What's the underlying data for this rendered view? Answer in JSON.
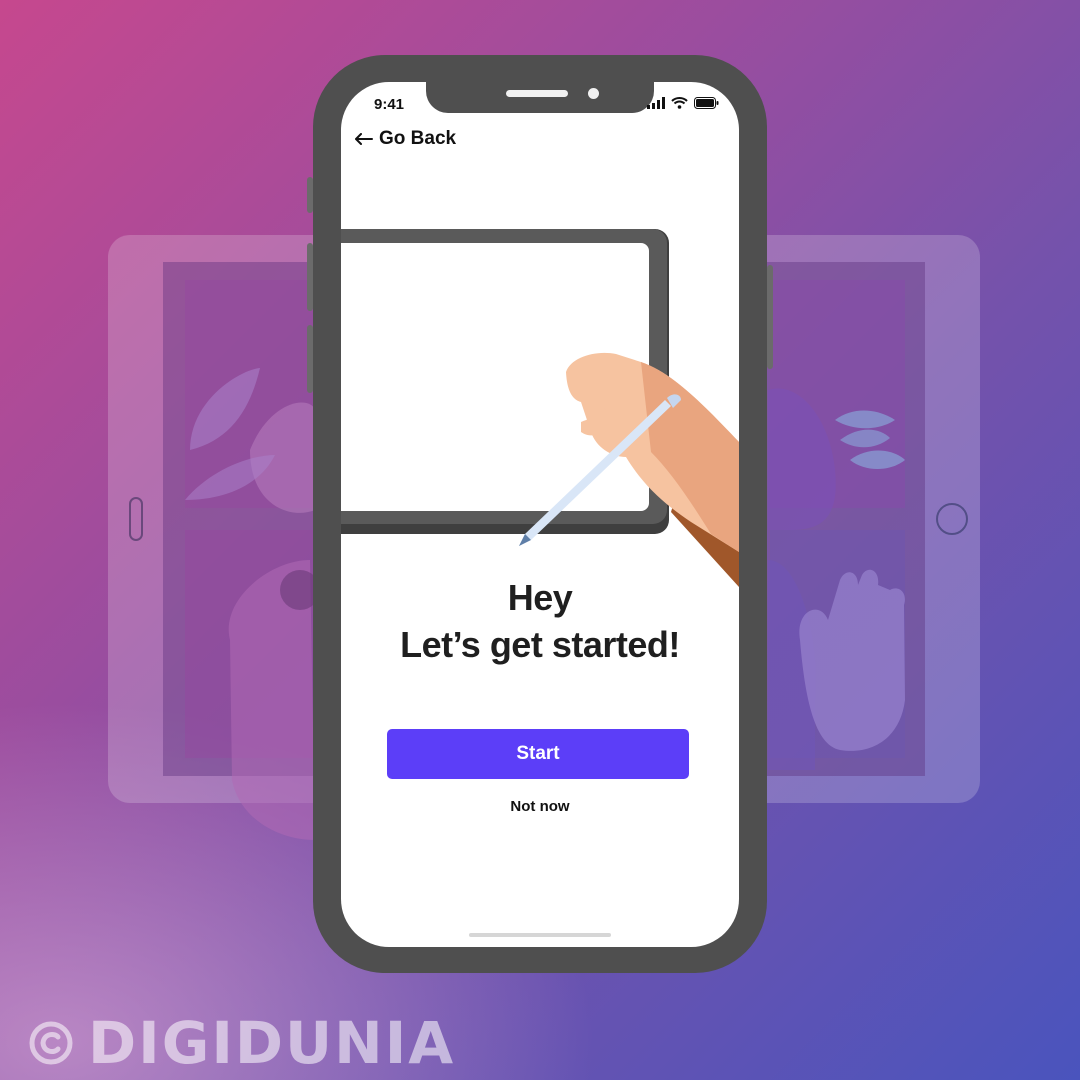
{
  "status_bar": {
    "time": "9:41"
  },
  "nav": {
    "back_label": "Go Back",
    "back_icon": "arrow-left-icon"
  },
  "headline": {
    "line1": "Hey",
    "line2": "Let’s get started!"
  },
  "actions": {
    "start_label": "Start",
    "secondary_label": "Not now"
  },
  "watermark": {
    "symbol": "©",
    "text": "DIGIDUNIA"
  },
  "colors": {
    "accent": "#5c3ef8",
    "phone_frame": "#4f4f4f",
    "background_start": "#c6488e",
    "background_end": "#4a54bd"
  }
}
